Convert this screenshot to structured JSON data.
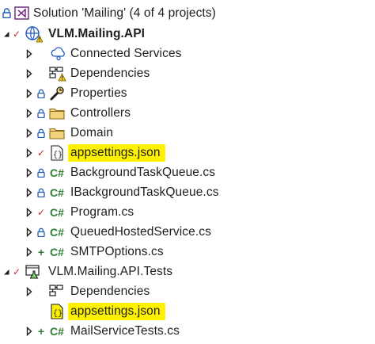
{
  "solution": {
    "label": "Solution 'Mailing' (4 of 4 projects)"
  },
  "projects": [
    {
      "name": "VLM.Mailing.API",
      "items": [
        {
          "label": "Connected Services"
        },
        {
          "label": "Dependencies"
        },
        {
          "label": "Properties"
        },
        {
          "label": "Controllers"
        },
        {
          "label": "Domain"
        },
        {
          "label": "appsettings.json",
          "highlighted": true
        },
        {
          "label": "BackgroundTaskQueue.cs"
        },
        {
          "label": "IBackgroundTaskQueue.cs"
        },
        {
          "label": "Program.cs"
        },
        {
          "label": "QueuedHostedService.cs"
        },
        {
          "label": "SMTPOptions.cs"
        }
      ]
    },
    {
      "name": "VLM.Mailing.API.Tests",
      "items": [
        {
          "label": "Dependencies"
        },
        {
          "label": "appsettings.json",
          "highlighted": true
        },
        {
          "label": "MailServiceTests.cs"
        }
      ]
    }
  ],
  "glyphs": {
    "csharp": "C#",
    "json": "{}"
  },
  "colors": {
    "highlight": "#fff200",
    "csharp_green": "#2e7d32",
    "modified_red": "#c62828",
    "folder_yellow": "#f2d27a",
    "vs_purple": "#68217a",
    "lock_blue": "#1e5bb8"
  }
}
